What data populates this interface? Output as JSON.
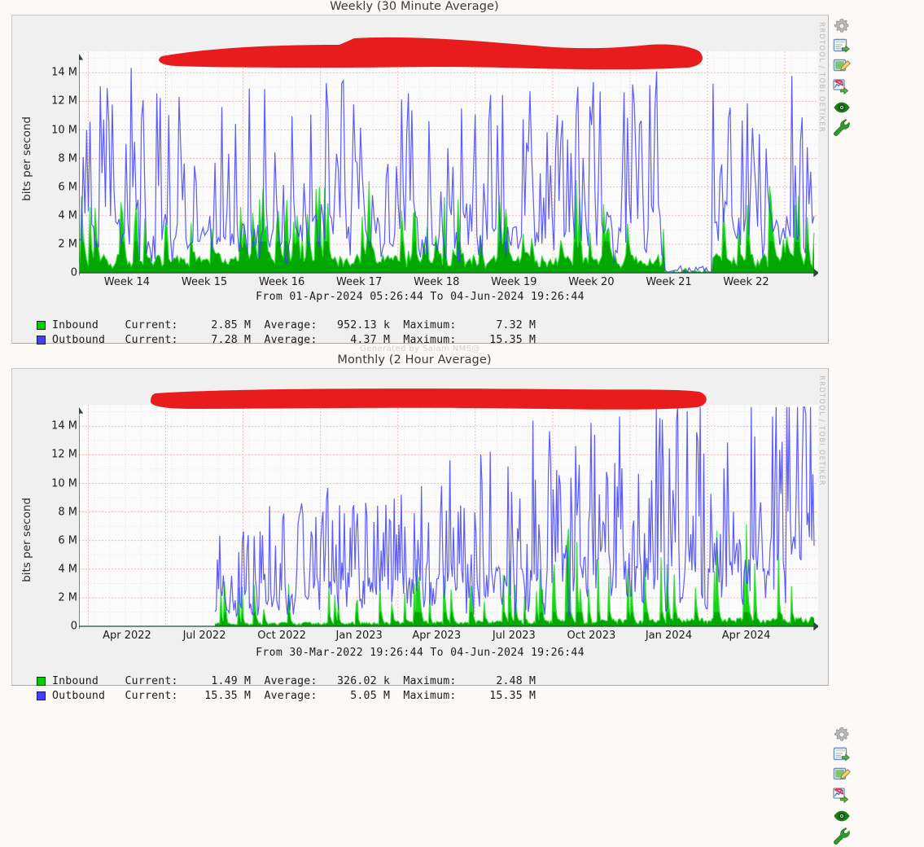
{
  "page": {
    "background": "#fdf9f7",
    "panel_bg": "#f0f0f0",
    "panel_border": "#c6c6c6"
  },
  "colors": {
    "inbound": "#00cc00",
    "inbound_dark": "#00a000",
    "outbound": "#4040ff",
    "grid_major": "#f2b8b8",
    "grid_minor": "#dedede",
    "axis": "#2b4a3a",
    "redaction": "#e81c1c"
  },
  "rail_icons": [
    {
      "name": "gear-icon",
      "title": "Settings"
    },
    {
      "name": "export-image-icon",
      "title": "Export"
    },
    {
      "name": "edit-graph-icon",
      "title": "Edit Graph"
    },
    {
      "name": "remove-graph-icon",
      "title": "Remove Graph"
    },
    {
      "name": "view-icon",
      "title": "View"
    },
    {
      "name": "wrench-icon",
      "title": "Tools"
    }
  ],
  "graphs": [
    {
      "id": "weekly",
      "title": "Weekly (30 Minute Average)",
      "watermark": "RRDTOOL / TOBI OETIKER",
      "ylabel": "bits per second",
      "yticks": [
        "0",
        "2 M",
        "4 M",
        "6 M",
        "8 M",
        "10 M",
        "12 M",
        "14 M"
      ],
      "xticks": [
        "Week 14",
        "Week 15",
        "Week 16",
        "Week 17",
        "Week 18",
        "Week 19",
        "Week 20",
        "Week 21",
        "Week 22"
      ],
      "range_text": "From 01-Apr-2024 05:26:44 To 04-Jun-2024 19:26:44",
      "generated_by": "Generated by Salam NMS@",
      "legend": [
        {
          "name": "Inbound",
          "color": "#00cc00",
          "line": "Inbound    Current:     2.85 M  Average:   952.13 k  Maximum:      7.32 M"
        },
        {
          "name": "Outbound",
          "color": "#4040ff",
          "line": "Outbound   Current:     7.28 M  Average:     4.37 M  Maximum:     15.35 M"
        }
      ]
    },
    {
      "id": "monthly",
      "title": "Monthly (2 Hour Average)",
      "watermark": "RRDTOOL / TOBI OETIKER",
      "ylabel": "bits per second",
      "yticks": [
        "0",
        "2 M",
        "4 M",
        "6 M",
        "8 M",
        "10 M",
        "12 M",
        "14 M"
      ],
      "xticks": [
        "Apr 2022",
        "Jul 2022",
        "Oct 2022",
        "Jan 2023",
        "Apr 2023",
        "Jul 2023",
        "Oct 2023",
        "Jan 2024",
        "Apr 2024"
      ],
      "range_text": "From 30-Mar-2022 19:26:44 To 04-Jun-2024 19:26:44",
      "generated_by": "",
      "legend": [
        {
          "name": "Inbound",
          "color": "#00cc00",
          "line": "Inbound    Current:     1.49 M  Average:   326.02 k  Maximum:      2.48 M"
        },
        {
          "name": "Outbound",
          "color": "#4040ff",
          "line": "Outbound   Current:    15.35 M  Average:     5.05 M  Maximum:     15.35 M"
        }
      ]
    }
  ],
  "chart_data": [
    {
      "type": "area",
      "title": "Weekly (30 Minute Average)",
      "xlabel": "",
      "ylabel": "bits per second",
      "ylim": [
        0,
        15500000
      ],
      "yticks": [
        0,
        2000000,
        4000000,
        6000000,
        8000000,
        10000000,
        12000000,
        14000000
      ],
      "ytick_labels": [
        "0",
        "2 M",
        "4 M",
        "6 M",
        "8 M",
        "10 M",
        "12 M",
        "14 M"
      ],
      "x_tick_labels": [
        "Week 14",
        "Week 15",
        "Week 16",
        "Week 17",
        "Week 18",
        "Week 19",
        "Week 20",
        "Week 21",
        "Week 22"
      ],
      "x_range": [
        "01-Apr-2024 05:26:44",
        "04-Jun-2024 19:26:44"
      ],
      "grid": true,
      "legend_position": "below",
      "series": [
        {
          "name": "Inbound",
          "color": "#00cc00",
          "style": "area",
          "current": 2850000,
          "average": 952130,
          "maximum": 7320000,
          "current_label": "2.85 M",
          "average_label": "952.13 k",
          "maximum_label": "7.32 M"
        },
        {
          "name": "Outbound",
          "color": "#4040ff",
          "style": "line",
          "current": 7280000,
          "average": 4370000,
          "maximum": 15350000,
          "current_label": "7.28 M",
          "average_label": "4.37 M",
          "maximum_label": "15.35 M"
        }
      ]
    },
    {
      "type": "area",
      "title": "Monthly (2 Hour Average)",
      "xlabel": "",
      "ylabel": "bits per second",
      "ylim": [
        0,
        15500000
      ],
      "yticks": [
        0,
        2000000,
        4000000,
        6000000,
        8000000,
        10000000,
        12000000,
        14000000
      ],
      "ytick_labels": [
        "0",
        "2 M",
        "4 M",
        "6 M",
        "8 M",
        "10 M",
        "12 M",
        "14 M"
      ],
      "x_tick_labels": [
        "Apr 2022",
        "Jul 2022",
        "Oct 2022",
        "Jan 2023",
        "Apr 2023",
        "Jul 2023",
        "Oct 2023",
        "Jan 2024",
        "Apr 2024"
      ],
      "x_range": [
        "30-Mar-2022 19:26:44",
        "04-Jun-2024 19:26:44"
      ],
      "grid": true,
      "legend_position": "below",
      "series": [
        {
          "name": "Inbound",
          "color": "#00cc00",
          "style": "area",
          "current": 1490000,
          "average": 326020,
          "maximum": 2480000,
          "current_label": "1.49 M",
          "average_label": "326.02 k",
          "maximum_label": "2.48 M"
        },
        {
          "name": "Outbound",
          "color": "#4040ff",
          "style": "line",
          "current": 15350000,
          "average": 5050000,
          "maximum": 15350000,
          "current_label": "15.35 M",
          "average_label": "5.05 M",
          "maximum_label": "15.35 M"
        }
      ]
    }
  ]
}
